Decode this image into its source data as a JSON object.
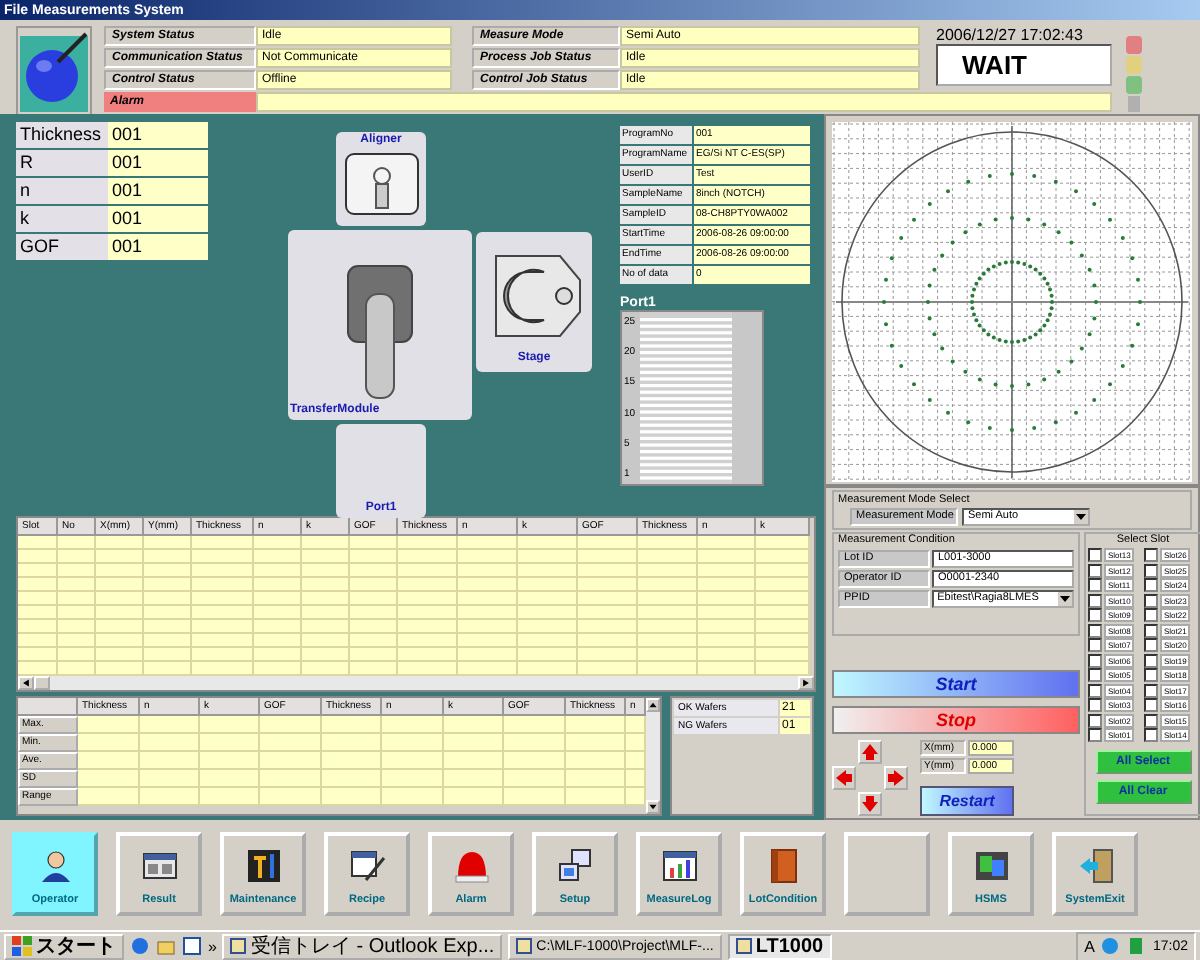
{
  "window": {
    "title": "File Measurements System"
  },
  "status_left": [
    {
      "label": "System Status",
      "value": "Idle"
    },
    {
      "label": "Communication Status",
      "value": "Not Communicate"
    },
    {
      "label": "Control Status",
      "value": "Offline"
    }
  ],
  "status_right": [
    {
      "label": "Measure Mode",
      "value": "Semi Auto"
    },
    {
      "label": "Process Job Status",
      "value": "Idle"
    },
    {
      "label": "Control Job Status",
      "value": "Idle"
    }
  ],
  "alarm": {
    "label": "Alarm"
  },
  "datetime": "2006/12/27 17:02:43",
  "state_display": "WAIT",
  "results": [
    {
      "label": "Thickness",
      "value": "001"
    },
    {
      "label": "R",
      "value": "001"
    },
    {
      "label": "n",
      "value": "001"
    },
    {
      "label": "k",
      "value": "001"
    },
    {
      "label": "GOF",
      "value": "001"
    }
  ],
  "transfer_diagram": {
    "units": [
      {
        "kind": "aligner",
        "label": "Aligner"
      },
      {
        "kind": "transfer",
        "label": "TransferModule"
      },
      {
        "kind": "stage",
        "label": "Stage"
      },
      {
        "kind": "port",
        "label": "Port1"
      }
    ]
  },
  "program_info": [
    {
      "label": "ProgramNo",
      "value": "001"
    },
    {
      "label": "ProgramName",
      "value": "EG/Si NT C-ES(SP)"
    },
    {
      "label": "UserID",
      "value": "Test"
    },
    {
      "label": "SampleName",
      "value": "8inch (NOTCH)"
    },
    {
      "label": "SampleID",
      "value": "08-CH8PTY0WA002"
    },
    {
      "label": "StartTime",
      "value": "2006-08-26 09:00:00"
    },
    {
      "label": "EndTime",
      "value": "2006-08-26 09:00:00"
    },
    {
      "label": "No of data",
      "value": "0"
    }
  ],
  "cassette": {
    "title": "Port1",
    "ticks": [
      "25",
      "20",
      "15",
      "10",
      "5",
      "1"
    ]
  },
  "data_table": {
    "columns": [
      "Slot",
      "No",
      "X(mm)",
      "Y(mm)",
      "Thickness",
      "n",
      "k",
      "GOF",
      "Thickness",
      "n",
      "k",
      "GOF",
      "Thickness",
      "n",
      "k"
    ]
  },
  "stats_table": {
    "columns": [
      "Thickness",
      "n",
      "k",
      "GOF",
      "Thickness",
      "n",
      "k",
      "GOF",
      "Thickness",
      "n"
    ],
    "rows": [
      "Max.",
      "Min.",
      "Ave.",
      "SD",
      "Range"
    ]
  },
  "wafer_counts": [
    {
      "label": "OK Wafers",
      "value": "21"
    },
    {
      "label": "NG Wafers",
      "value": "01"
    }
  ],
  "mode_select": {
    "title": "Measurement Mode Select",
    "label": "Measurement Mode",
    "value": "Semi Auto"
  },
  "condition": {
    "title": "Measurement Condition",
    "fields": [
      {
        "label": "Lot ID",
        "value": "L001-3000",
        "kind": "text"
      },
      {
        "label": "Operator ID",
        "value": "O0001-2340",
        "kind": "text"
      },
      {
        "label": "PPID",
        "value": "Ebitest\\Ragia8LMES",
        "kind": "select"
      }
    ]
  },
  "actions": {
    "start": "Start",
    "stop": "Stop",
    "restart": "Restart"
  },
  "position": [
    {
      "label": "X(mm)",
      "value": "0.000"
    },
    {
      "label": "Y(mm)",
      "value": "0.000"
    }
  ],
  "slot_select": {
    "title": "Select Slot",
    "slots": [
      {
        "label": "Slot13",
        "checked": false
      },
      {
        "label": "Slot12",
        "checked": false
      },
      {
        "label": "Slot11",
        "checked": false
      },
      {
        "label": "Slot10",
        "checked": false
      },
      {
        "label": "Slot09",
        "checked": false
      },
      {
        "label": "Slot08",
        "checked": false
      },
      {
        "label": "Slot07",
        "checked": false
      },
      {
        "label": "Slot06",
        "checked": false
      },
      {
        "label": "Slot05",
        "checked": false
      },
      {
        "label": "Slot04",
        "checked": false
      },
      {
        "label": "Slot03",
        "checked": false
      },
      {
        "label": "Slot02",
        "checked": false
      },
      {
        "label": "Slot01",
        "checked": false
      },
      {
        "label": "Slot26",
        "checked": false
      },
      {
        "label": "Slot25",
        "checked": false
      },
      {
        "label": "Slot24",
        "checked": false
      },
      {
        "label": "Slot23",
        "checked": false
      },
      {
        "label": "Slot22",
        "checked": false
      },
      {
        "label": "Slot21",
        "checked": false
      },
      {
        "label": "Slot20",
        "checked": false
      },
      {
        "label": "Slot19",
        "checked": false
      },
      {
        "label": "Slot18",
        "checked": false
      },
      {
        "label": "Slot17",
        "checked": false
      },
      {
        "label": "Slot16",
        "checked": false
      },
      {
        "label": "Slot15",
        "checked": false
      },
      {
        "label": "Slot14",
        "checked": false
      }
    ],
    "buttons": [
      "All Select",
      "All Clear"
    ]
  },
  "toolbar": [
    {
      "label": "Operator",
      "selected": true
    },
    {
      "label": "Result",
      "selected": false
    },
    {
      "label": "Maintenance",
      "selected": false
    },
    {
      "label": "Recipe",
      "selected": false
    },
    {
      "label": "Alarm",
      "selected": false
    },
    {
      "label": "Setup",
      "selected": false
    },
    {
      "label": "MeasureLog",
      "selected": false
    },
    {
      "label": "LotCondition",
      "selected": false
    },
    {
      "selected": false
    },
    {
      "label": "HSMS",
      "selected": false
    },
    {
      "label": "SystemExit",
      "selected": false
    }
  ],
  "taskbar": {
    "start": "スタート",
    "more": "»",
    "tasks": [
      {
        "label": "受信トレイ - Outlook Exp...",
        "active": false
      },
      {
        "label": "C:\\MLF-1000\\Project\\MLF-...",
        "active": false
      },
      {
        "label": "LT1000",
        "active": true
      }
    ],
    "ime": "A",
    "clock": "17:02"
  }
}
